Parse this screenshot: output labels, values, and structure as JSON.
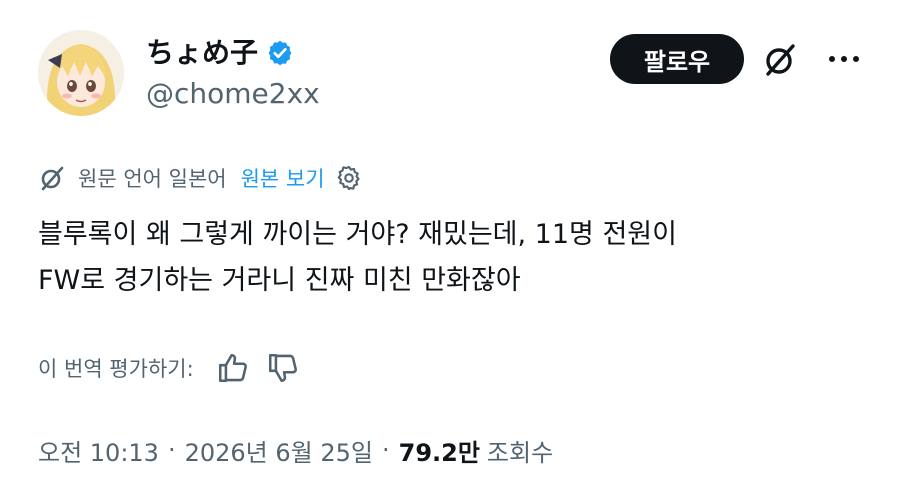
{
  "author": {
    "display_name": "ちょめ子",
    "handle": "@chome2xx",
    "verified": true,
    "avatar_icon": "anime-girl-avatar"
  },
  "actions": {
    "follow_label": "팔로우",
    "grok_icon": "grok-icon",
    "more_icon": "more-icon"
  },
  "translation": {
    "info": "원문 언어 일본어",
    "show_original": "원본 보기",
    "settings_icon": "gear-icon"
  },
  "tweet": {
    "line1": "블루록이 왜 그렇게 까이는 거야? 재밌는데, 11명 전원이",
    "line2": "FW로 경기하는 거라니 진짜 미친 만화잖아"
  },
  "rating": {
    "label": "이 번역 평가하기:"
  },
  "meta": {
    "time": "오전 10:13",
    "separator": "·",
    "date": "2026년 6월 25일",
    "views_count": "79.2만",
    "views_label": "조회수"
  },
  "colors": {
    "text": "#0f1419",
    "secondary": "#536471",
    "accent": "#1d9bf0",
    "follow_bg": "#0f1419"
  }
}
